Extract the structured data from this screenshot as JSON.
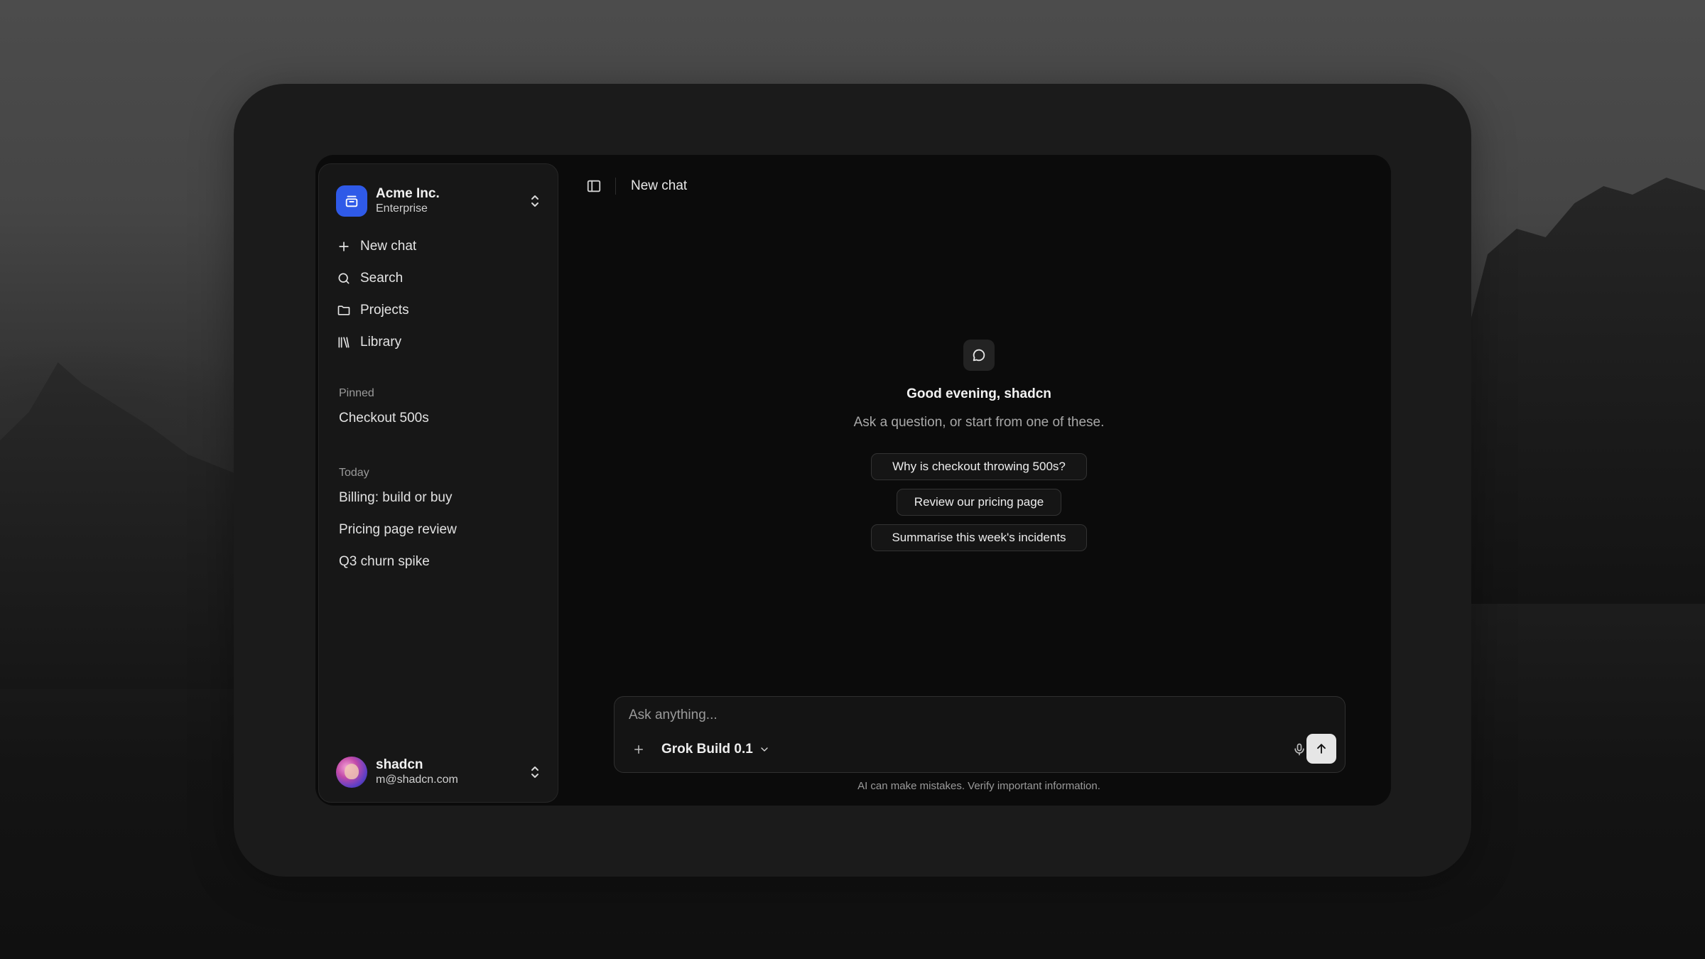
{
  "workspace": {
    "name": "Acme Inc.",
    "plan": "Enterprise"
  },
  "nav": [
    {
      "label": "New chat",
      "icon": "plus-icon"
    },
    {
      "label": "Search",
      "icon": "search-icon"
    },
    {
      "label": "Projects",
      "icon": "folder-icon"
    },
    {
      "label": "Library",
      "icon": "library-icon"
    }
  ],
  "pinned": {
    "label": "Pinned",
    "items": [
      "Checkout 500s"
    ]
  },
  "today": {
    "label": "Today",
    "items": [
      "Billing: build or buy",
      "Pricing page review",
      "Q3 churn spike"
    ]
  },
  "user": {
    "name": "shadcn",
    "email": "m@shadcn.com"
  },
  "header": {
    "title": "New chat"
  },
  "empty_state": {
    "greeting": "Good evening, shadcn",
    "subtitle": "Ask a question, or start from one of these.",
    "suggestions": [
      "Why is checkout throwing 500s?",
      "Review our pricing page",
      "Summarise this week's incidents"
    ]
  },
  "composer": {
    "placeholder": "Ask anything...",
    "value": "",
    "model": "Grok Build 0.1"
  },
  "footer": {
    "disclaimer": "AI can make mistakes. Verify important information."
  },
  "colors": {
    "accent": "#2f5ae8",
    "background": "#0b0b0b",
    "sidebar": "#171717"
  }
}
